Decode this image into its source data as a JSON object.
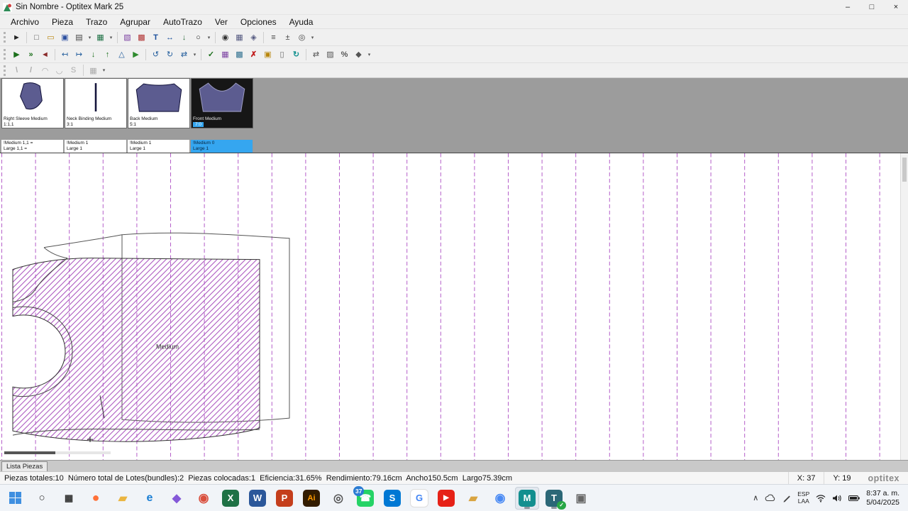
{
  "window": {
    "title": "Sin Nombre - Optitex Mark 25",
    "min": "–",
    "max": "□",
    "close": "×"
  },
  "menu": {
    "items": [
      {
        "n": "archivo",
        "g": "Archivo"
      },
      {
        "n": "pieza",
        "g": "Pieza"
      },
      {
        "n": "trazo",
        "g": "Trazo"
      },
      {
        "n": "agrupar",
        "g": "Agrupar"
      },
      {
        "n": "autotrazo",
        "g": "AutoTrazo"
      },
      {
        "n": "ver",
        "g": "Ver"
      },
      {
        "n": "opciones",
        "g": "Opciones"
      },
      {
        "n": "ayuda",
        "g": "Ayuda"
      }
    ]
  },
  "toolbars": {
    "row1": [
      {
        "n": "select-pointer",
        "g": "►",
        "s": "color:#222"
      },
      {
        "sep": 1
      },
      {
        "n": "new-marker",
        "g": "□",
        "s": "color:#555"
      },
      {
        "n": "open-marker",
        "g": "▭",
        "s": "color:#b8860b"
      },
      {
        "n": "save-marker",
        "g": "▣",
        "s": "color:#2b4fa0"
      },
      {
        "n": "print-marker",
        "g": "▤",
        "s": "color:#444"
      },
      {
        "car": 1,
        "g": "▾"
      },
      {
        "n": "export-excel",
        "g": "▦",
        "s": "color:#1e7145"
      },
      {
        "car": 1,
        "g": "▾"
      },
      {
        "sep": 1
      },
      {
        "n": "marker-properties",
        "g": "▧",
        "s": "color:#7a3fa0"
      },
      {
        "n": "pieces-report",
        "g": "▩",
        "s": "color:#b03030"
      },
      {
        "n": "text-tool",
        "g": "T",
        "s": "color:#1a4f9c;font-weight:bold"
      },
      {
        "n": "measure-tool",
        "g": "↔",
        "s": "color:#1a4f9c"
      },
      {
        "n": "pin-tool",
        "g": "↓",
        "s": "color:#2f6f3f"
      },
      {
        "n": "zoom-tool",
        "g": "○",
        "s": "color:#222"
      },
      {
        "car": 1,
        "g": "▾"
      },
      {
        "sep": 1
      },
      {
        "n": "find-piece",
        "g": "◉",
        "s": "color:#333"
      },
      {
        "n": "grid-toggle",
        "g": "▦",
        "s": "color:#555a80"
      },
      {
        "n": "snap-toggle",
        "g": "◈",
        "s": "color:#555a80"
      },
      {
        "sep": 1
      },
      {
        "n": "ruler-toggle",
        "g": "≡",
        "s": "color:#444"
      },
      {
        "n": "units-tool",
        "g": "±",
        "s": "color:#444"
      },
      {
        "n": "marker-settings",
        "g": "◎",
        "s": "color:#444"
      },
      {
        "car": 1,
        "g": "▾"
      }
    ],
    "row2": [
      {
        "n": "place-piece",
        "g": "▶",
        "s": "color:#1b6f1b"
      },
      {
        "n": "place-all",
        "g": "»",
        "s": "color:#1b6f1b;font-weight:bold"
      },
      {
        "n": "unplace-piece",
        "g": "◄",
        "s": "color:#8a2b2b"
      },
      {
        "sep": 1
      },
      {
        "n": "slide-left",
        "g": "↤",
        "s": "color:#215c9c"
      },
      {
        "n": "slide-right",
        "g": "↦",
        "s": "color:#215c9c"
      },
      {
        "n": "slide-down",
        "g": "↓",
        "s": "color:#1b6f1b;font-weight:bold"
      },
      {
        "n": "slide-up",
        "g": "↑",
        "s": "color:#1b6f1b;font-weight:bold"
      },
      {
        "n": "flip-vertical",
        "g": "△",
        "s": "color:#215c9c"
      },
      {
        "n": "place-next",
        "g": "▶",
        "s": "color:#2e8b2e"
      },
      {
        "sep": 1
      },
      {
        "n": "rotate-ccw",
        "g": "↺",
        "s": "color:#215c9c"
      },
      {
        "n": "rotate-cw",
        "g": "↻",
        "s": "color:#215c9c"
      },
      {
        "n": "flip-horizontal",
        "g": "⇄",
        "s": "color:#215c9c"
      },
      {
        "car": 1,
        "g": "▾"
      },
      {
        "sep": 1
      },
      {
        "n": "overlap-check",
        "g": "✓",
        "s": "color:#1b6f1b;font-weight:bold"
      },
      {
        "n": "bundle-table",
        "g": "▦",
        "s": "color:#7a3fa0"
      },
      {
        "n": "lot-table",
        "g": "▩",
        "s": "color:#2e6f8f"
      },
      {
        "n": "delete-piece",
        "g": "✗",
        "s": "color:#c01818;font-weight:bold"
      },
      {
        "n": "verify-marker",
        "g": "▣",
        "s": "color:#b8860b"
      },
      {
        "n": "draft-mode",
        "g": "▯",
        "s": "color:#666"
      },
      {
        "n": "refresh-marker",
        "g": "↻",
        "s": "color:#13918f;font-weight:bold"
      },
      {
        "sep": 1
      },
      {
        "n": "swap-pieces",
        "g": "⇄",
        "s": "color:#555"
      },
      {
        "n": "fabric-matching",
        "g": "▨",
        "s": "color:#555"
      },
      {
        "n": "efficiency-tool",
        "g": "%",
        "s": "color:#555;font-weight:bold"
      },
      {
        "n": "marker-options",
        "g": "◆",
        "s": "color:#555"
      },
      {
        "car": 1,
        "g": "▾"
      }
    ],
    "row3": [
      {
        "n": "line-tool",
        "g": "\\",
        "s": "color:#aaa;font-weight:bold"
      },
      {
        "n": "polyline-tool",
        "g": "/",
        "s": "color:#aaa;font-weight:bold"
      },
      {
        "n": "arc-tool",
        "g": "◠",
        "s": "color:#aaa"
      },
      {
        "n": "curve-tool",
        "g": "◡",
        "s": "color:#aaa"
      },
      {
        "n": "spline-tool",
        "g": "S",
        "s": "color:#aaa"
      },
      {
        "sep": 1
      },
      {
        "n": "trace-grid",
        "g": "▦",
        "s": "color:#aaa"
      },
      {
        "car": 1,
        "g": "▾"
      }
    ]
  },
  "pieces": {
    "cards": [
      {
        "name": "Right Sleeve Medium",
        "ratio": "1:1,1"
      },
      {
        "name": "Neck Binding Medium",
        "ratio": "3:1"
      },
      {
        "name": "Back Medium",
        "ratio": "5:1"
      },
      {
        "name": "Front Medium",
        "ratio": "7:0"
      }
    ]
  },
  "sizes": {
    "cells": [
      {
        "l1": "!Medium 1,1 =",
        "l2": "Large 1,1 ="
      },
      {
        "l1": "!Medium 1",
        "l2": "Large 1"
      },
      {
        "l1": "!Medium 1",
        "l2": "Large 1"
      },
      {
        "l1": "!Medium 0",
        "l2": "Large 1"
      }
    ]
  },
  "canvas": {
    "piece_label": "Medium"
  },
  "panel": {
    "tab": "Lista Piezas"
  },
  "status": {
    "summary": "Piezas totales:10  Número total de Lotes(bundles):2  Piezas colocadas:1  Eficiencia:31.65%  Rendimiento:79.16cm  Ancho150.5cm  Largo75.39cm",
    "x": "X: 37",
    "y": "Y: 19",
    "brand": "optitex"
  },
  "taskbar": {
    "apps": [
      {
        "n": "search",
        "g": "○",
        "s": "color:#333;font-size:15px"
      },
      {
        "n": "task-view",
        "g": "▦",
        "s": "color:#333"
      },
      {
        "n": "firefox",
        "g": "●",
        "s": "color:#ff7139;font-size:18px"
      },
      {
        "n": "file-explorer",
        "g": "▰",
        "s": "color:#eab541;font-size:16px"
      },
      {
        "n": "edge",
        "g": "e",
        "s": "color:#1b7fd4;font-size:16px"
      },
      {
        "n": "media-app",
        "g": "◆",
        "s": "color:#8458d8;font-size:16px"
      },
      {
        "n": "chrome",
        "g": "◉",
        "s": "color:#d94f3d;font-size:17px"
      },
      {
        "n": "excel",
        "g": "X",
        "s": "background:#1e7145;color:#fff"
      },
      {
        "n": "word",
        "g": "W",
        "s": "background:#2b579a;color:#fff"
      },
      {
        "n": "powerpoint",
        "g": "P",
        "s": "background:#c43e1c;color:#fff"
      },
      {
        "n": "illustrator",
        "g": "Ai",
        "s": "background:#331c00;color:#ff9a00;font-size:11px"
      },
      {
        "n": "phone-link",
        "g": "◎",
        "s": "color:#555;font-size:16px"
      },
      {
        "n": "whatsapp",
        "g": "☎",
        "s": "background:#25d366;color:#fff",
        "b": "37"
      },
      {
        "n": "skype",
        "g": "S",
        "s": "background:#0078d4;color:#fff"
      },
      {
        "n": "google-app",
        "g": "G",
        "s": "background:#fff;color:#4285f4;box-shadow:0 0 0 1px #ddd"
      },
      {
        "n": "youtube",
        "g": "▶",
        "s": "background:#e62117;color:#fff;font-size:10px"
      },
      {
        "n": "folder-app",
        "g": "▰",
        "s": "color:#d9a441;font-size:16px"
      },
      {
        "n": "chrome-work",
        "g": "◉",
        "s": "color:#4a8af4;font-size:17px"
      },
      {
        "n": "optitex-mark",
        "g": "M",
        "s": "background:#128f8f;color:#fff",
        "cls": "active open"
      },
      {
        "n": "teamviewer",
        "g": "T",
        "s": "background:#2b6777;color:#fff",
        "cls": "open",
        "b": "✓",
        "bs": "background:#28a745;left:auto;right:0;top:auto;bottom:0;min-width:12px;height:12px;font-size:8px"
      },
      {
        "n": "photos-app",
        "g": "▣",
        "s": "color:#666;font-size:16px"
      }
    ],
    "tray": {
      "chevron": "∧",
      "lang1": "ESP",
      "lang2": "LAA",
      "time": "8:37 a. m.",
      "date": "5/04/2025"
    }
  }
}
